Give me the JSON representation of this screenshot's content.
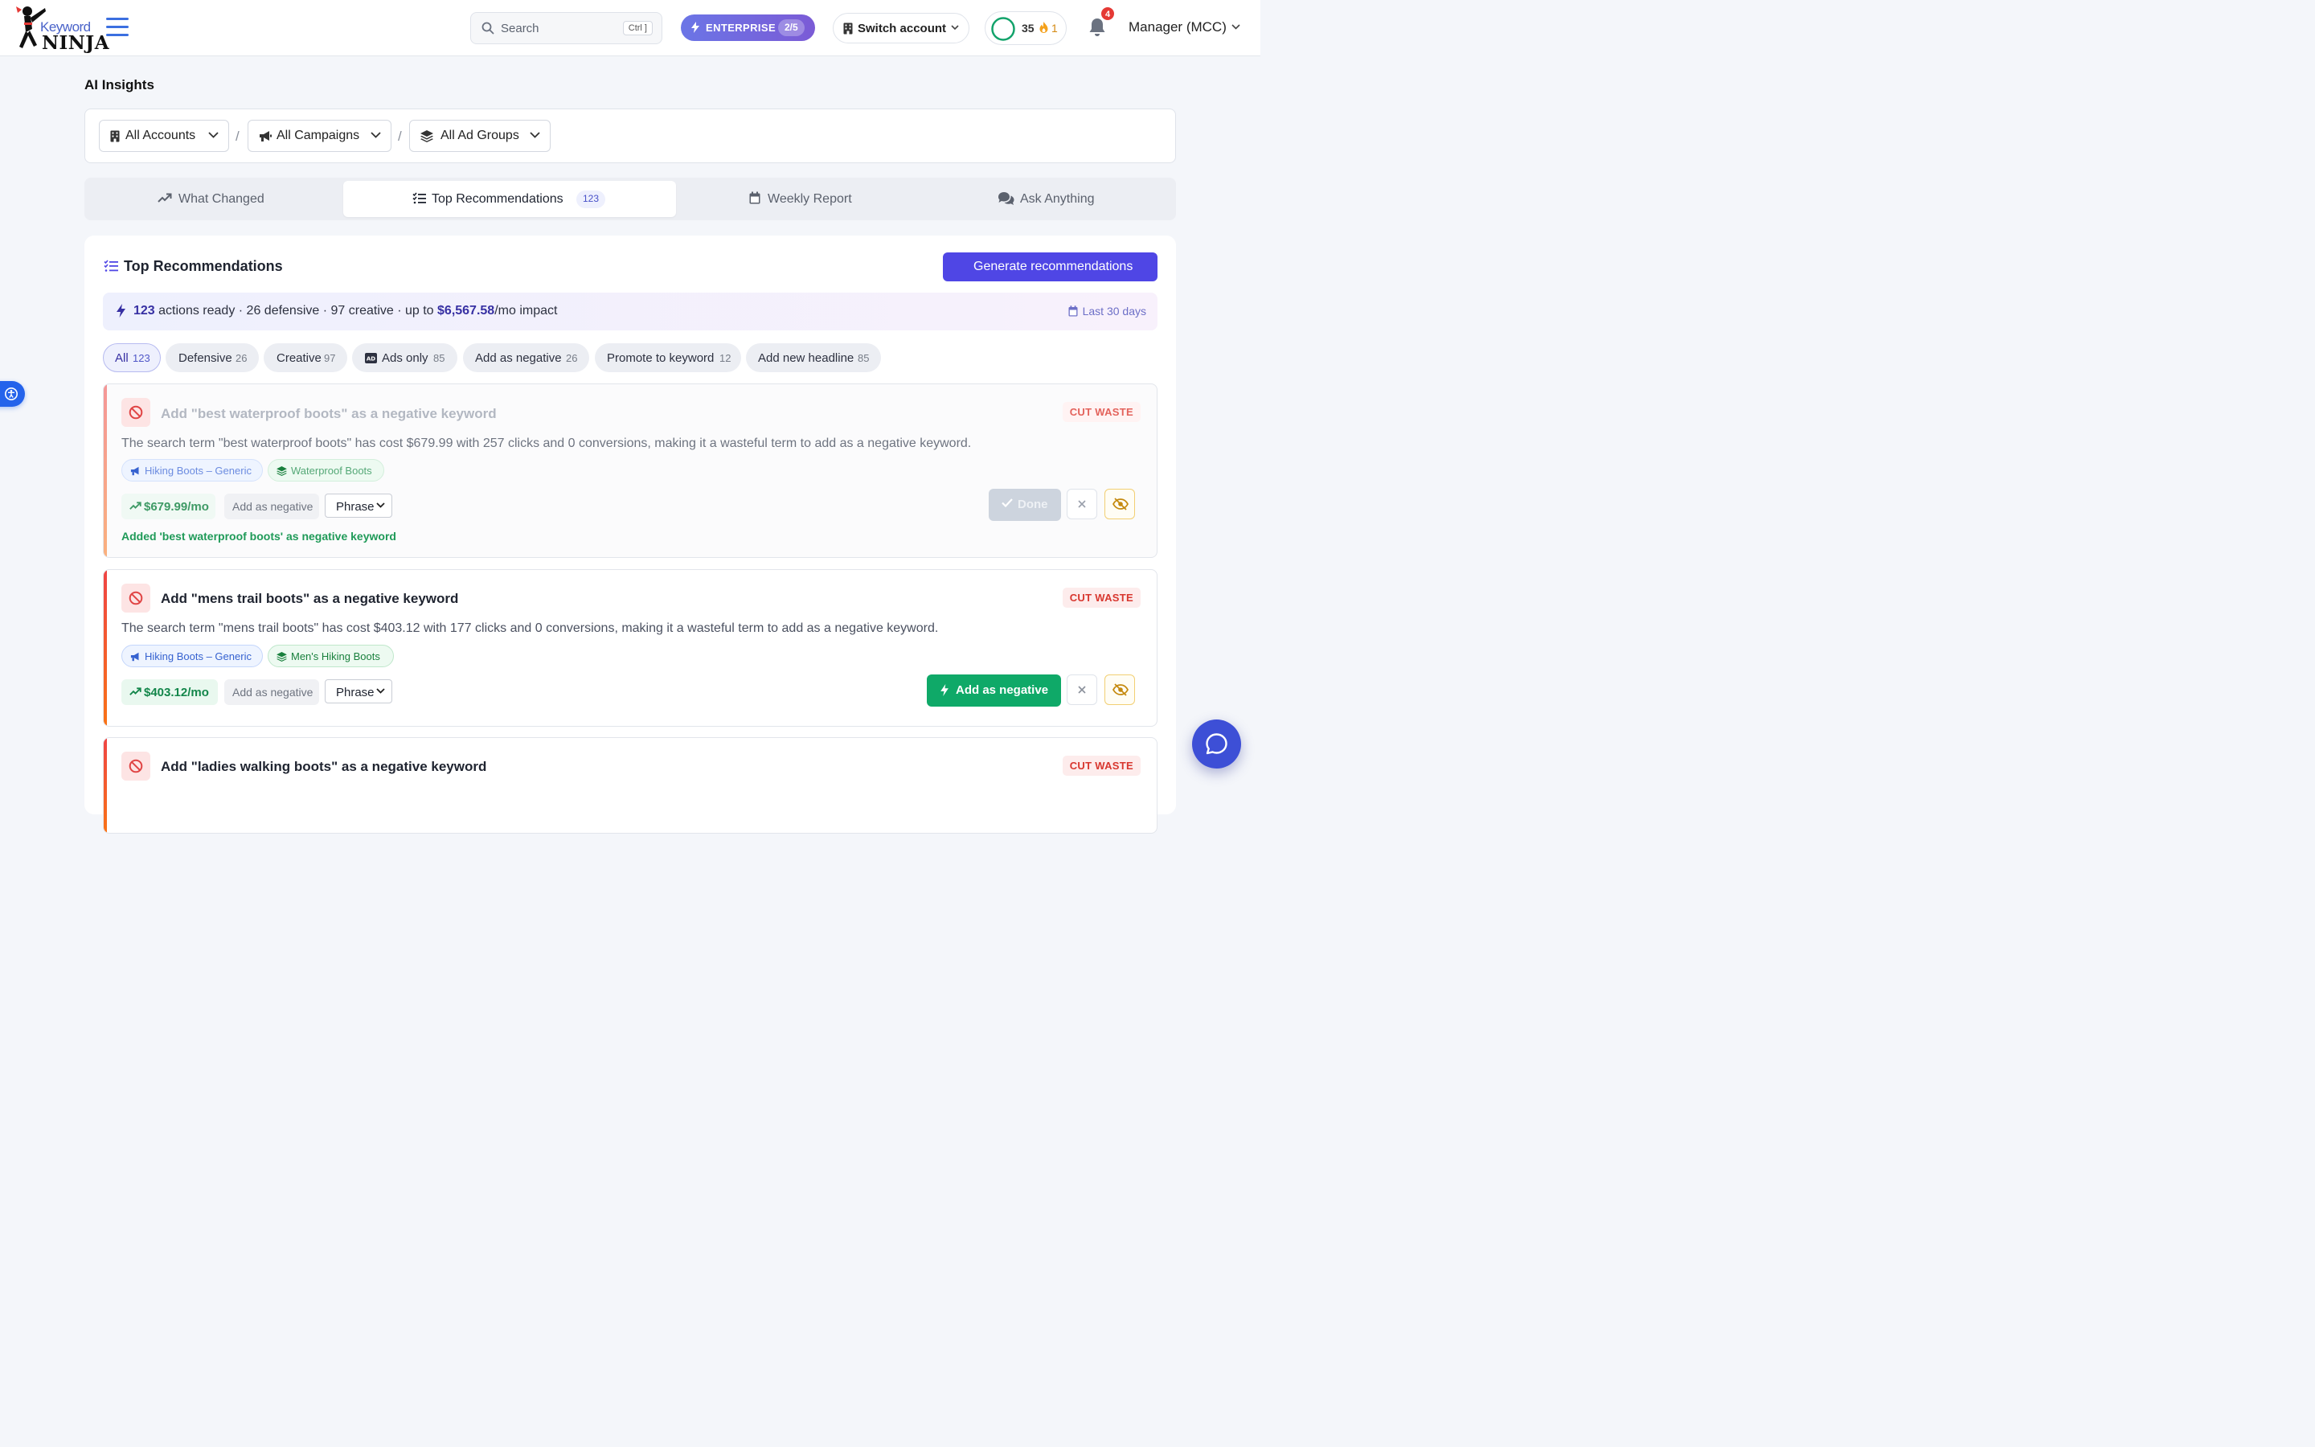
{
  "brand": {
    "logo_top": "Keyword",
    "logo_bottom": "NINJA"
  },
  "header": {
    "search_placeholder": "Search",
    "search_shortcut": "Ctrl ]",
    "plan_label": "ENTERPRISE",
    "plan_usage": "2/5",
    "switch_account_label": "Switch account",
    "credits": "35",
    "streak": "1",
    "notifications_count": "4",
    "account_label": "Manager (MCC)",
    "colors": {
      "plan_gradient_start": "#6b75e6",
      "plan_gradient_end": "#7b5bd6",
      "ring": "#13a36b"
    }
  },
  "page": {
    "title": "AI Insights",
    "filters": {
      "accounts": "All Accounts",
      "campaigns": "All Campaigns",
      "ad_groups": "All Ad Groups",
      "separator": "/"
    },
    "tabs": [
      {
        "label": "What Changed",
        "icon": "trend-icon"
      },
      {
        "label": "Top Recommendations",
        "icon": "list-check-icon",
        "count": "123"
      },
      {
        "label": "Weekly Report",
        "icon": "calendar-icon"
      },
      {
        "label": "Ask Anything",
        "icon": "comments-icon"
      }
    ]
  },
  "panel": {
    "title": "Top Recommendations",
    "generate_label": "Generate recommendations",
    "summary": {
      "actions": "123",
      "actions_text": "actions ready",
      "rest": " · 26 defensive · 97 creative · up to ",
      "impact": "$6,567.58",
      "impact_suffix": "/mo impact",
      "range": "Last 30 days"
    },
    "chips": [
      {
        "label": "All",
        "count": "123"
      },
      {
        "label": "Defensive",
        "count": "26"
      },
      {
        "label": "Creative",
        "count": "97"
      },
      {
        "label": "Ads only",
        "count": "85"
      },
      {
        "label": "Add as negative",
        "count": "26"
      },
      {
        "label": "Promote to keyword",
        "count": "12"
      },
      {
        "label": "Add new headline",
        "count": "85"
      }
    ]
  },
  "cards": [
    {
      "title": "Add \"best waterproof boots\" as a negative keyword",
      "tag": "CUT WASTE",
      "description": "The search term \"best waterproof boots\" has cost $679.99 with 257 clicks and 0 conversions, making it a wasteful term to add as a negative keyword.",
      "campaign": "Hiking Boots – Generic",
      "ad_group": "Waterproof Boots",
      "impact": "$679.99/mo",
      "action_label": "Add as negative",
      "match_type": "Phrase",
      "button_label": "Done",
      "result": "Added 'best waterproof boots' as negative keyword",
      "status": "done"
    },
    {
      "title": "Add \"mens trail boots\" as a negative keyword",
      "tag": "CUT WASTE",
      "description": "The search term \"mens trail boots\" has cost $403.12 with 177 clicks and 0 conversions, making it a wasteful term to add as a negative keyword.",
      "campaign": "Hiking Boots – Generic",
      "ad_group": "Men's Hiking Boots",
      "impact": "$403.12/mo",
      "action_label": "Add as negative",
      "match_type": "Phrase",
      "button_label": "Add as negative",
      "status": "pending"
    },
    {
      "title": "Add \"ladies walking boots\" as a negative keyword",
      "tag": "CUT WASTE",
      "status": "pending"
    }
  ]
}
